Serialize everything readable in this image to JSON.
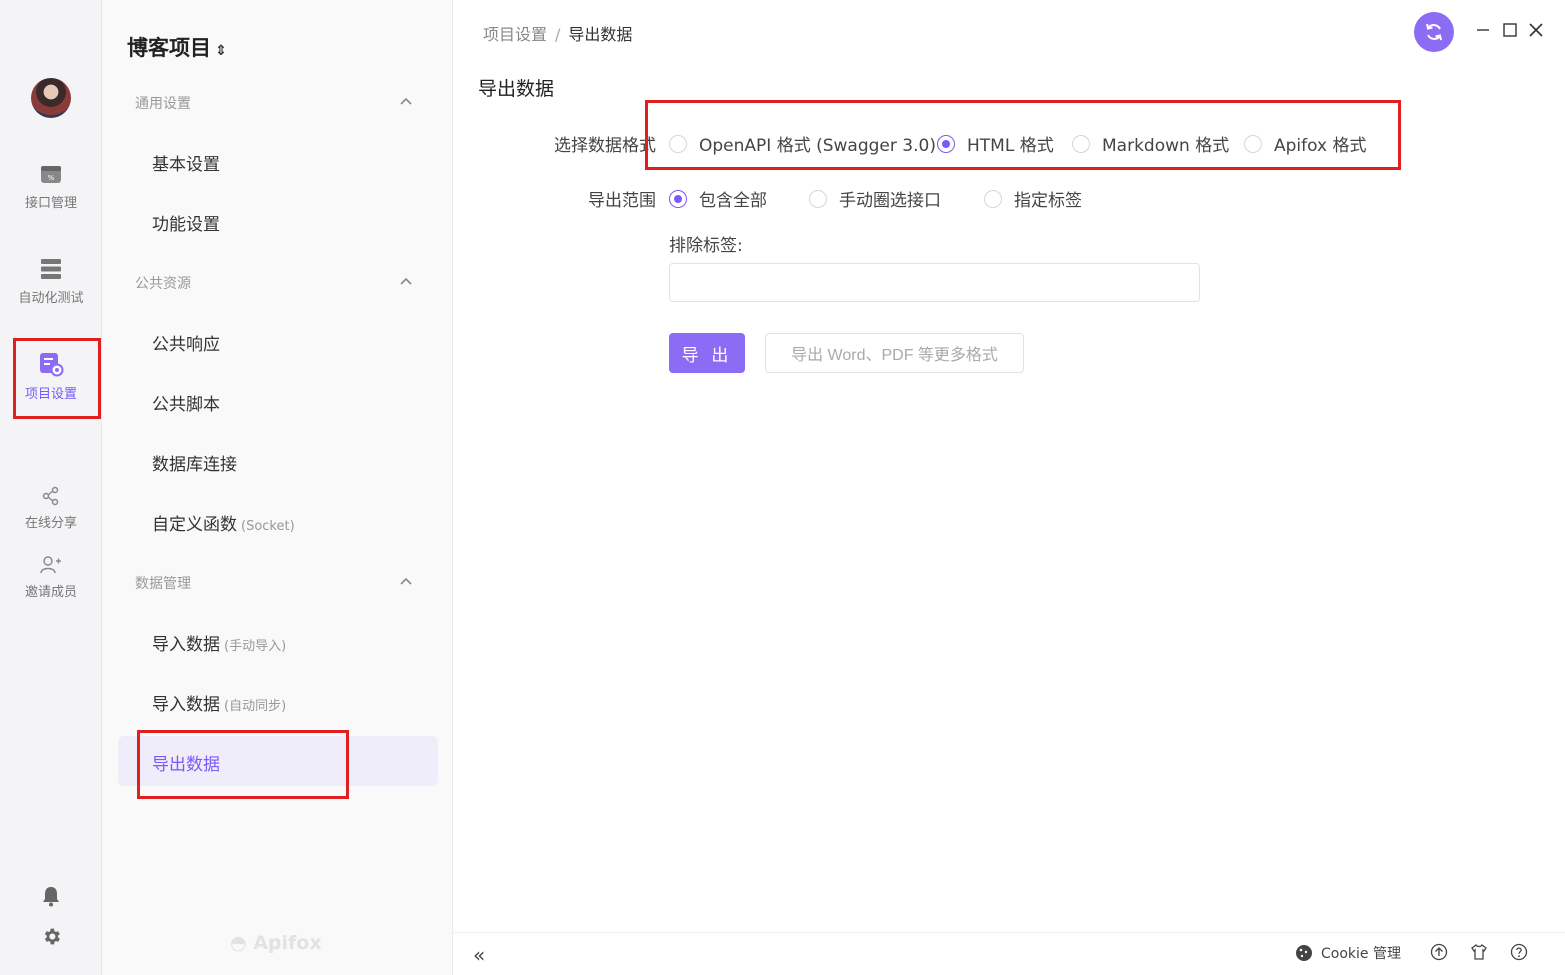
{
  "rail": {
    "items": [
      {
        "label": "接口管理"
      },
      {
        "label": "自动化测试"
      },
      {
        "label": "项目设置"
      },
      {
        "label": "在线分享"
      },
      {
        "label": "邀请成员"
      }
    ]
  },
  "sidebar": {
    "project_title": "博客项目",
    "groups": [
      {
        "label": "通用设置"
      },
      {
        "label": "公共资源"
      },
      {
        "label": "数据管理"
      }
    ],
    "items": [
      {
        "label": "基本设置"
      },
      {
        "label": "功能设置"
      },
      {
        "label": "公共响应"
      },
      {
        "label": "公共脚本"
      },
      {
        "label": "数据库连接"
      },
      {
        "label": "自定义函数",
        "hint": "(Socket)"
      },
      {
        "label": "导入数据",
        "hint": "(手动导入)"
      },
      {
        "label": "导入数据",
        "hint": "(自动同步)"
      },
      {
        "label": "导出数据"
      }
    ],
    "brand": "Apifox"
  },
  "header": {
    "breadcrumb": [
      "项目设置",
      "/",
      "导出数据"
    ]
  },
  "main": {
    "title": "导出数据",
    "format": {
      "label": "选择数据格式",
      "options": [
        "OpenAPI 格式 (Swagger 3.0)",
        "HTML 格式",
        "Markdown 格式",
        "Apifox 格式"
      ],
      "selected": "HTML 格式"
    },
    "scope": {
      "label": "导出范围",
      "options": [
        "包含全部",
        "手动圈选接口",
        "指定标签"
      ],
      "selected": "包含全部"
    },
    "exclude_label": "排除标签:",
    "exclude_value": "",
    "export_button": "导 出",
    "more_formats_button": "导出 Word、PDF 等更多格式"
  },
  "footer": {
    "collapse": "«",
    "cookie_label": "Cookie 管理"
  },
  "colors": {
    "accent": "#8c6cf5",
    "highlight": "#e02020"
  }
}
